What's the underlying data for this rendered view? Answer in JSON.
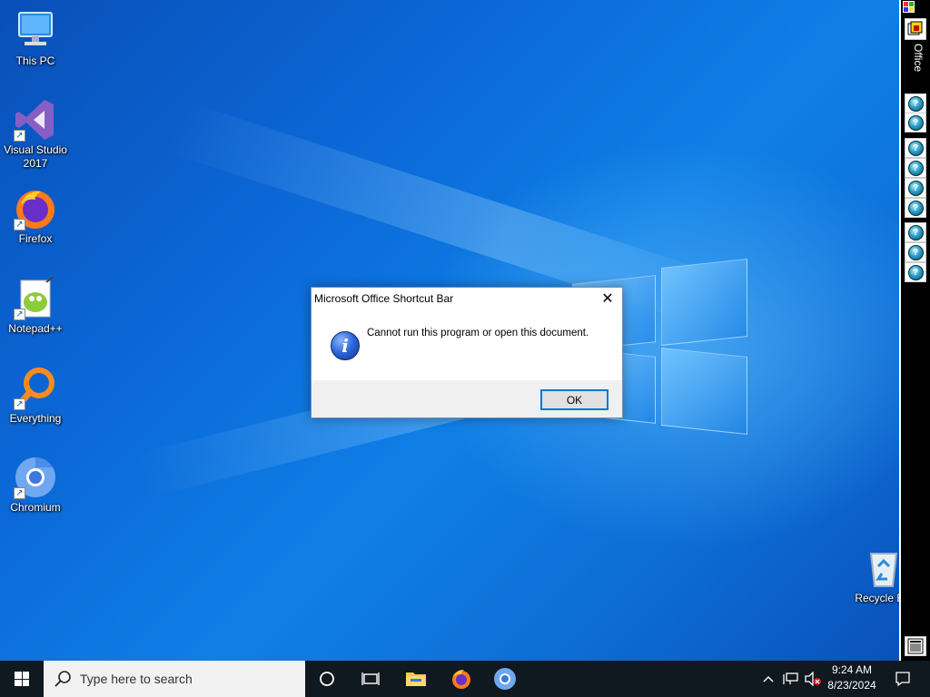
{
  "desktop_icons": [
    {
      "label": "This PC",
      "icon": "computer-icon"
    },
    {
      "label": "Visual Studio 2017",
      "icon": "visual-studio-icon"
    },
    {
      "label": "Firefox",
      "icon": "firefox-icon"
    },
    {
      "label": "Notepad++",
      "icon": "notepad-plus-plus-icon"
    },
    {
      "label": "Everything",
      "icon": "everything-search-icon"
    },
    {
      "label": "Chromium",
      "icon": "chromium-icon"
    },
    {
      "label": "Recycle Bin",
      "icon": "recycle-bin-icon"
    }
  ],
  "office_bar": {
    "label": "Office",
    "buttons": 10
  },
  "dialog": {
    "title": "Microsoft Office Shortcut Bar",
    "close_glyph": "✕",
    "icon": "info-icon",
    "message": "Cannot run this program or open this document.",
    "ok_label": "OK"
  },
  "taskbar": {
    "search_placeholder": "Type here to search",
    "pinned": [
      "cortana-icon",
      "task-view-icon",
      "file-explorer-icon",
      "firefox-icon",
      "chromium-icon"
    ],
    "time": "9:24 AM",
    "date": "8/23/2024"
  },
  "colors": {
    "accent": "#0078d7",
    "taskbar": "#101820",
    "search_bg": "#f2f2f2"
  }
}
